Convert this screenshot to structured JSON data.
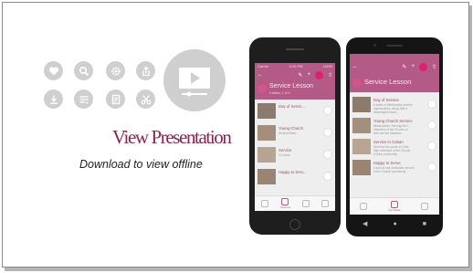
{
  "heading": {
    "title": "View Presentation",
    "subtitle": "Download to view offline"
  },
  "feature_icons": [
    "heart-icon",
    "search-icon",
    "gear-icon",
    "share-icon",
    "download-icon",
    "playlist-icon",
    "notes-icon",
    "scissors-icon"
  ],
  "big_icon": "video-player-icon",
  "colors": {
    "accent": "#8d2350",
    "header": "#b35a87",
    "download_badge": "#e0206f",
    "icon_circle": "#cfcfcf"
  },
  "iphone": {
    "status_carrier": "Carrier",
    "status_time": "4:20 PM",
    "status_battery": "100%",
    "lesson_title": "Service Lesson",
    "lesson_sub": "4 slides, 1 of 4",
    "items": [
      {
        "title": "Day of Servic..."
      },
      {
        "title": "Young Church",
        "desc": "Service Missi..."
      },
      {
        "title": "Service",
        "desc": "in Cuban"
      },
      {
        "title": "Happy to Serv..."
      }
    ],
    "nav_active_label": "Lessons"
  },
  "android": {
    "lesson_title": "Service Lesson",
    "items": [
      {
        "title": "Day of Service",
        "desc": "A week of Wednesday service\nopportunities, along with a\nmeaningful lesson"
      },
      {
        "title": "Young Church Service",
        "desc": "Missionaries: Serving the L...\nmembers of the Church on\ntheir service missions"
      },
      {
        "title": "Service in Cuban",
        "desc": "See how the youth of Cuba\nhelp members of the Church\nin their community"
      },
      {
        "title": "Happy to Serve",
        "desc": "A look at one dedicated servant\nin the Church community"
      }
    ],
    "nav_active_label": "My Media"
  }
}
